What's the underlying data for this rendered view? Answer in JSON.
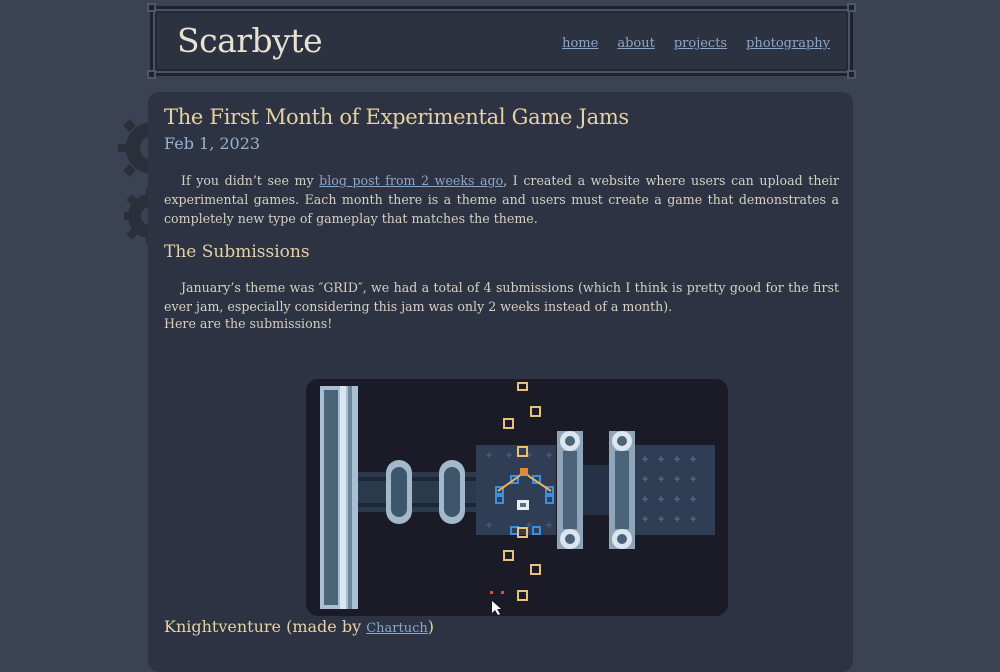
{
  "site": {
    "logo": "Scarbyte"
  },
  "nav": {
    "items": [
      "home",
      "about",
      "projects",
      "photography"
    ]
  },
  "post": {
    "title": "The First Month of Experimental Game Jams",
    "date": "Feb 1, 2023",
    "intro_before_link": "If you didn’t see my ",
    "intro_link": "blog post from 2 weeks ago",
    "intro_after_link": ", I created a website where users can upload their experimental games. Each month there is a theme and users must create a game that demonstrates a completely new type of gameplay that matches the theme.",
    "section_heading": "The Submissions",
    "submissions_text": "January’s theme was ″GRID″, we had a total of 4 submissions (which I think is pretty good for the first ever jam, especially considering this jam was only 2 weeks instead of a month).",
    "submissions_followup": "Here are the submissions!",
    "game": {
      "name_prefix": "Knightventure (made by ",
      "author": "Chartuch",
      "name_suffix": ")",
      "screenshot_icon": "game-screenshot"
    }
  },
  "colors": {
    "page_bg": "#3a4253",
    "card_bg": "#2d3342",
    "heading": "#e4d2a4",
    "link": "#8aa6c8",
    "date": "#98b2d2"
  }
}
